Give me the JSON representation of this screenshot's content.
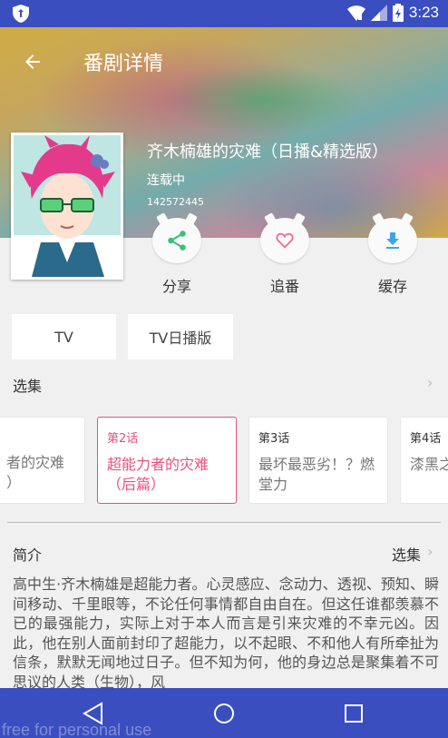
{
  "status_bar": {
    "time": "3:23"
  },
  "toolbar": {
    "title": "番剧详情"
  },
  "anime": {
    "title": "齐木楠雄的灾难（日播&精选版）",
    "status": "连载中",
    "id_text": "142572445"
  },
  "actions": [
    {
      "label": "分享",
      "icon": "share-icon"
    },
    {
      "label": "追番",
      "icon": "heart-icon"
    },
    {
      "label": "缓存",
      "icon": "download-icon"
    }
  ],
  "versions": [
    "TV",
    "TV日播版"
  ],
  "episodes_section": {
    "title": "选集"
  },
  "episodes": [
    {
      "num": "",
      "name": "者的灾难\n）"
    },
    {
      "num": "第2话",
      "name": "超能力者的灾难\n（后篇）"
    },
    {
      "num": "第3话",
      "name": "最坏最恶劣！？燃\n堂力"
    },
    {
      "num": "第4话",
      "name": "漆黑之"
    }
  ],
  "intro": {
    "title": "简介",
    "link": "选集",
    "text": "高中生·齐木楠雄是超能力者。心灵感应、念动力、透视、预知、瞬间移动、千里眼等，不论任何事情都自由自在。但这任谁都羡慕不已的最强能力，实际上对于本人而言是引来灾难的不幸元凶。因此，他在别人面前封印了超能力，以不起眼、不和他人有所牵扯为信条，默默无闻地过日子。但不知为何，他的身边总是聚集着不可思议的人类（生物），风"
  },
  "watermark": "free for personal use",
  "colors": {
    "accent": "#e8507d",
    "system_bar": "#3a4ec0",
    "icon_green": "#3cbf7c",
    "icon_pink": "#f26b9a",
    "icon_blue": "#3aa6e8"
  }
}
